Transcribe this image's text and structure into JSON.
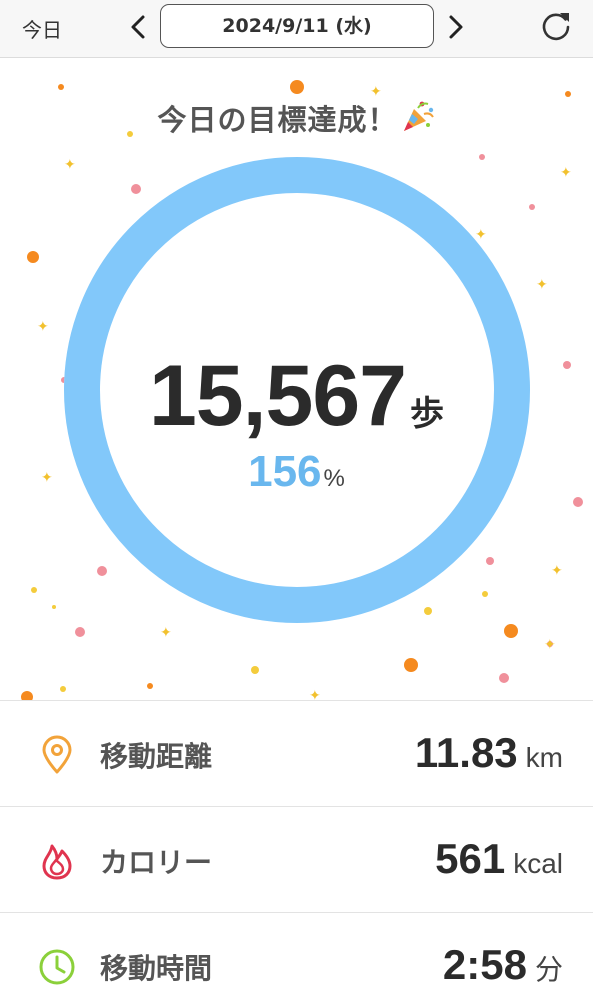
{
  "header": {
    "today_label": "今日",
    "date": "2024/9/11 (水)"
  },
  "summary": {
    "title": "今日の目標達成！",
    "steps": "15,567",
    "steps_unit": "歩",
    "percent": "156",
    "percent_unit": "%",
    "progress_fraction": 1.0,
    "ring_color": "#82c8fa"
  },
  "stats": [
    {
      "icon": "location-pin-icon",
      "label": "移動距離",
      "value": "11.83",
      "unit": "km",
      "color": "#f2a33a"
    },
    {
      "icon": "flame-icon",
      "label": "カロリー",
      "value": "561",
      "unit": "kcal",
      "color": "#e0344f"
    },
    {
      "icon": "clock-icon",
      "label": "移動時間",
      "value": "2:58",
      "unit": "分",
      "color": "#8bd03a"
    }
  ]
}
